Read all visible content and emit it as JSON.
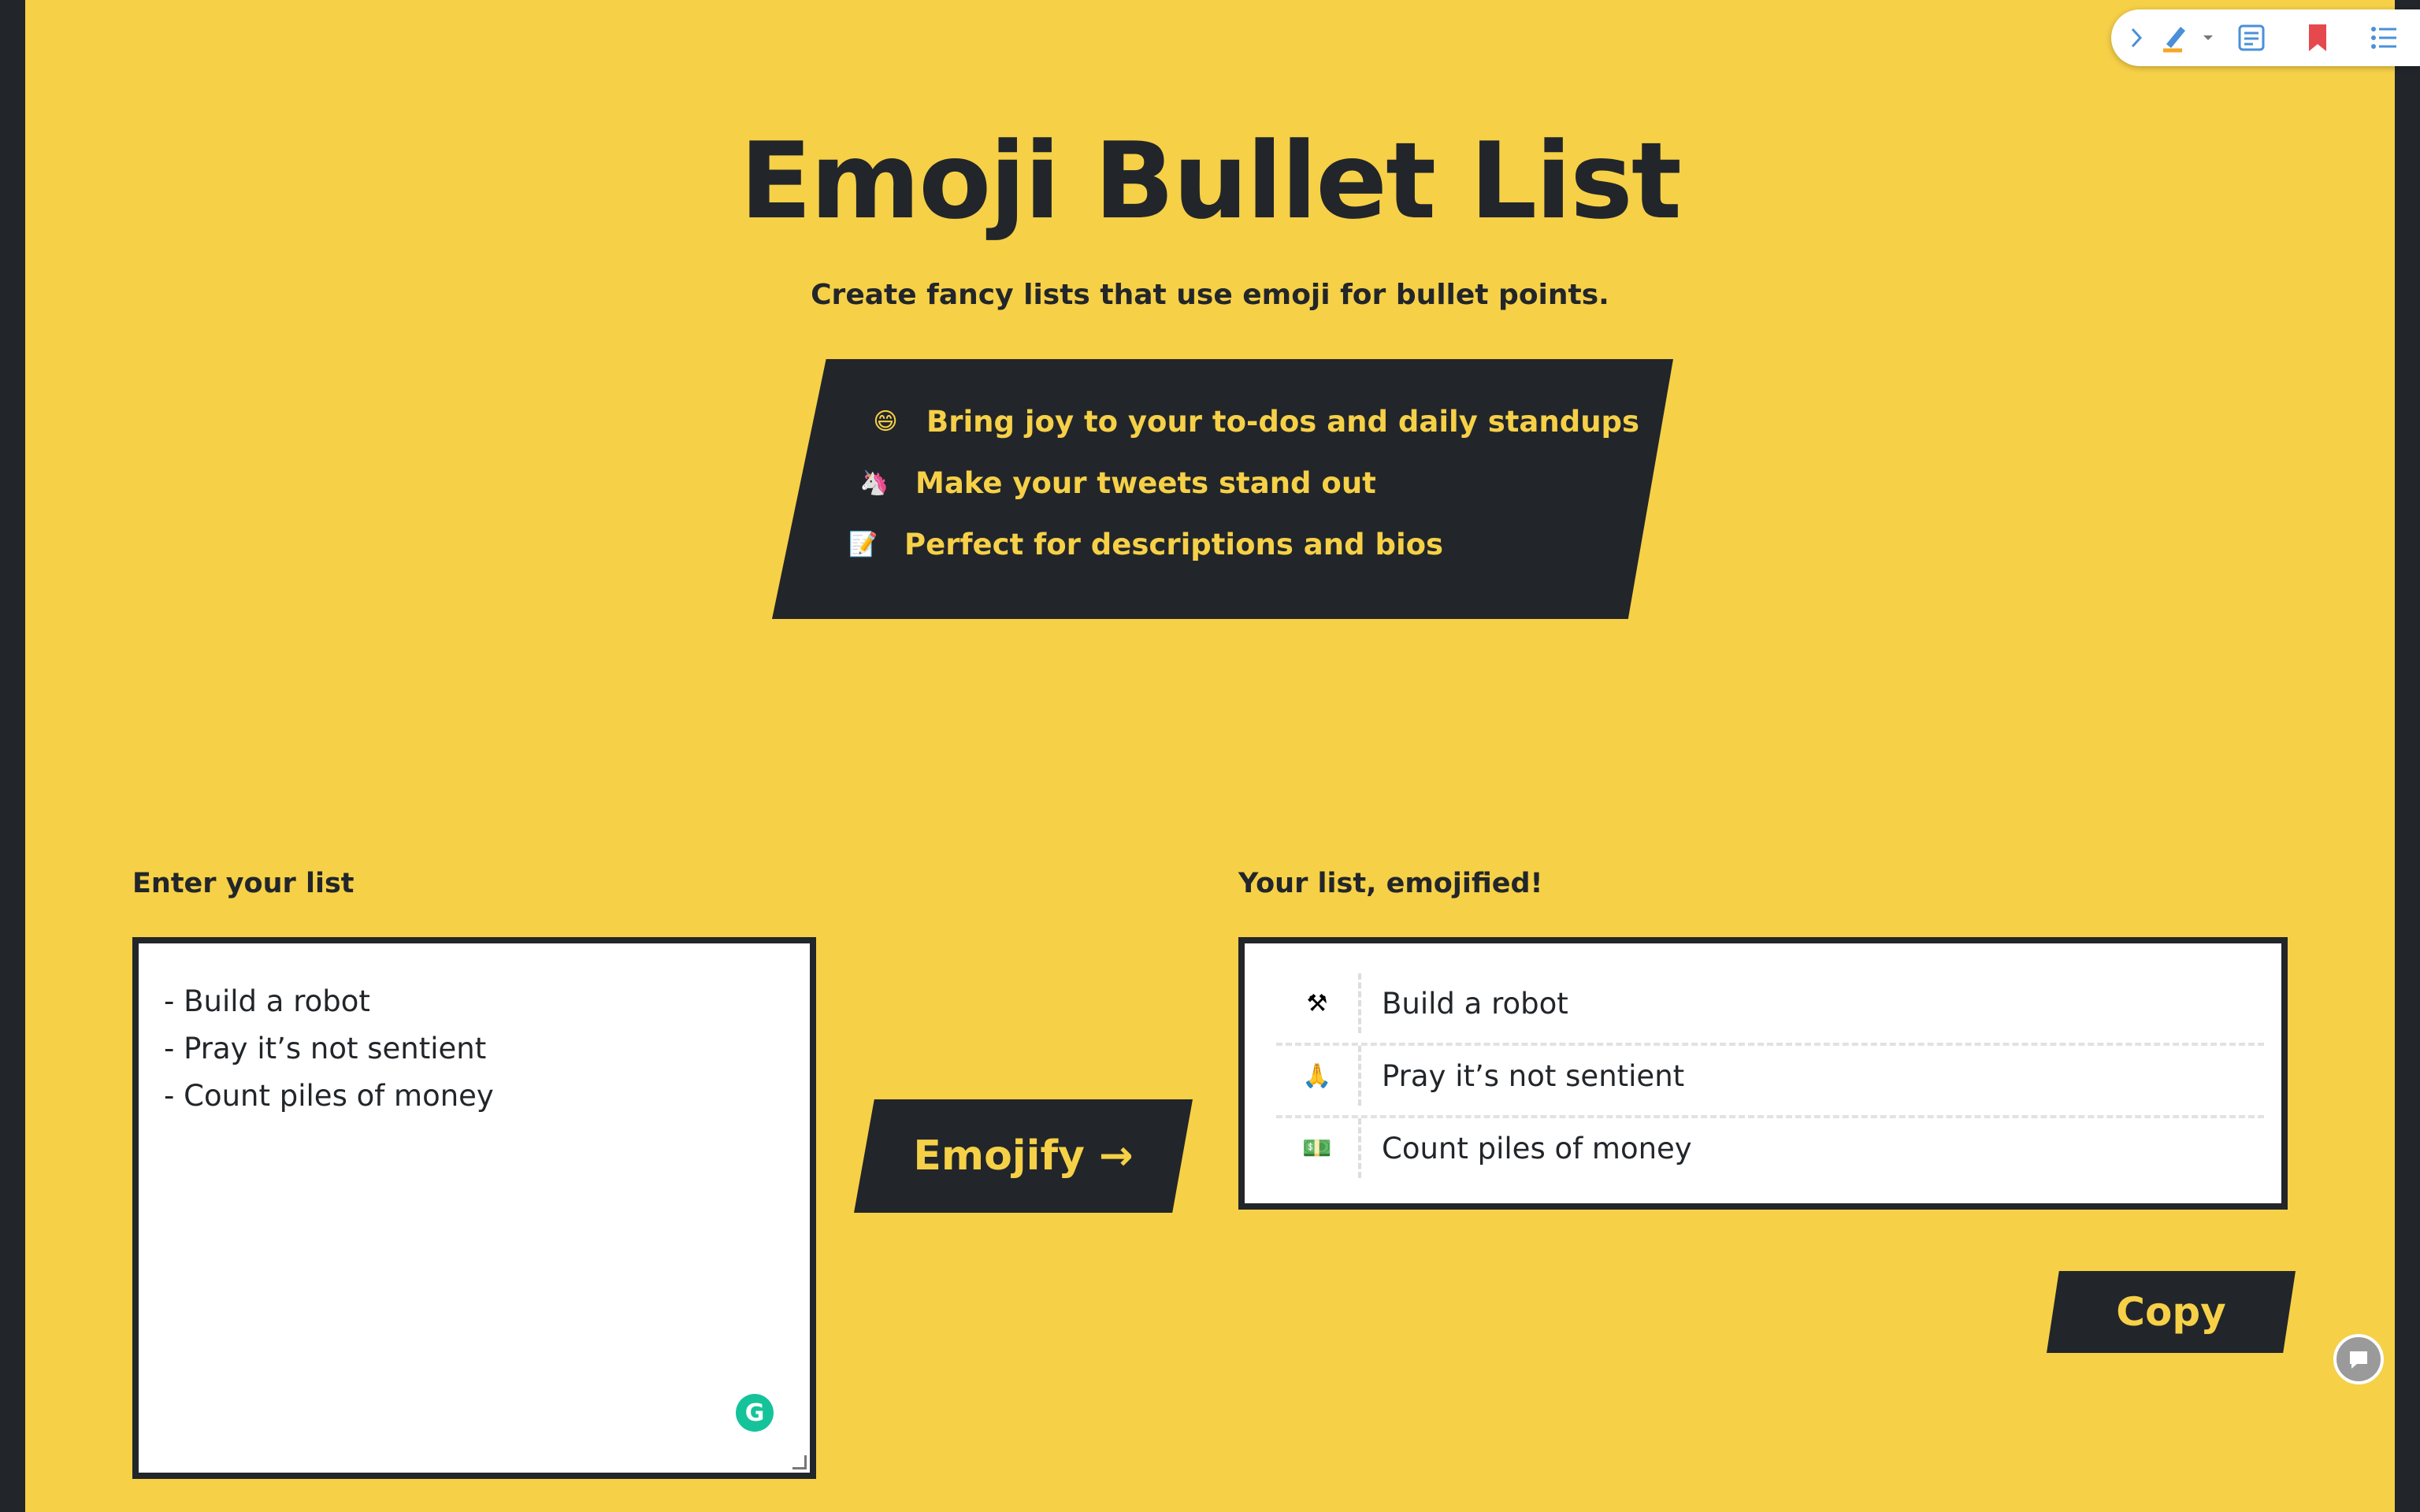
{
  "header": {
    "title": "Emoji Bullet List",
    "subtitle": "Create fancy lists that use emoji for bullet points."
  },
  "features": [
    {
      "emoji": "😄",
      "text": "Bring joy to your to-dos and daily standups"
    },
    {
      "emoji": "🦄",
      "text": "Make your tweets stand out"
    },
    {
      "emoji": "📝",
      "text": "Perfect for descriptions and bios"
    }
  ],
  "input": {
    "label": "Enter your list",
    "lines": [
      "- Build a robot",
      "- Pray it’s not sentient",
      "- Count piles of money"
    ]
  },
  "emojify_button": "Emojify →",
  "output": {
    "label": "Your list, emojified!",
    "items": [
      {
        "emoji": "⚒",
        "text": "Build a robot"
      },
      {
        "emoji": "🙏",
        "text": "Pray it’s not sentient"
      },
      {
        "emoji": "💵",
        "text": "Count piles of money"
      }
    ]
  },
  "copy_button": "Copy",
  "extension_toolbar": {
    "icons": [
      "chevron-right-icon",
      "highlighter-icon",
      "dropdown-arrow-icon",
      "note-icon",
      "bookmark-icon",
      "list-icon"
    ]
  },
  "colors": {
    "background": "#f6d047",
    "dark": "#22262a",
    "grammarly": "#15c39a",
    "bookmark": "#e5484d",
    "toolbar_icon": "#4a90d9"
  }
}
